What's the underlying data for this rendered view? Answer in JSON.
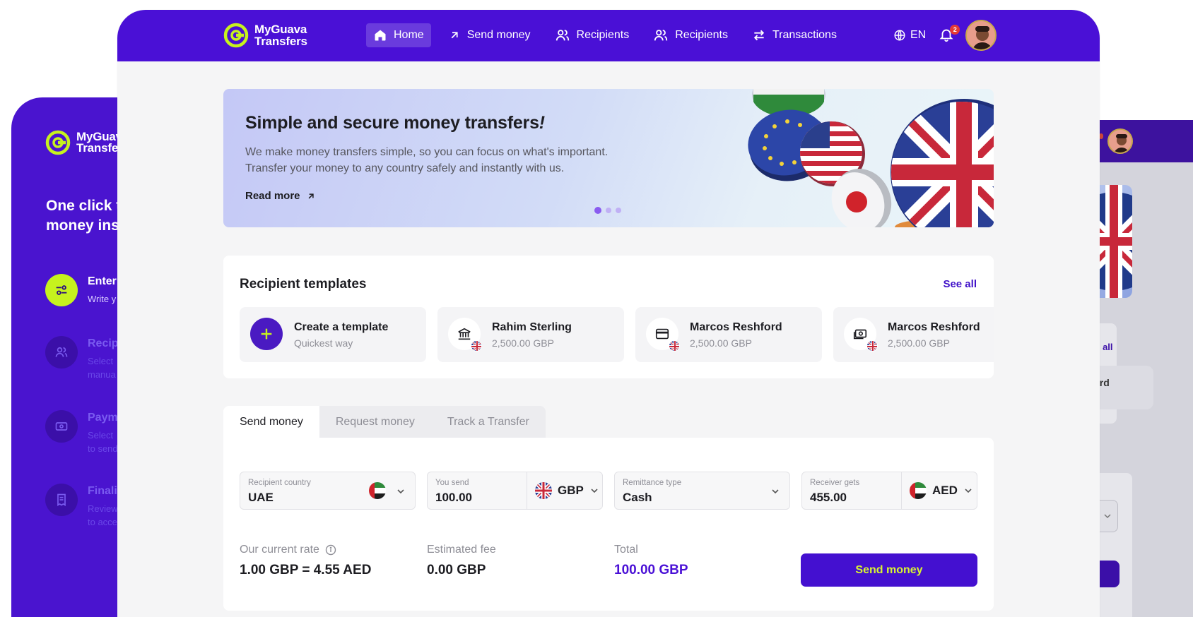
{
  "brand": {
    "line1": "MyGuava",
    "line2": "Transfers",
    "accent": "#c6f21e",
    "primary": "#4a10d6"
  },
  "back_left": {
    "brand": {
      "line1": "MyGuava",
      "line2": "Transfers"
    },
    "heading": "One click to send money instantly",
    "heading_visible": [
      "One click t",
      "money ins"
    ],
    "steps": [
      {
        "title": "Enter",
        "desc": [
          "Write y"
        ],
        "icon": "sliders-icon",
        "state": "active"
      },
      {
        "title": "Recip",
        "desc": [
          "Select",
          "manua"
        ],
        "icon": "users-icon",
        "state": "dim"
      },
      {
        "title": "Paym",
        "desc": [
          "Select",
          "to send"
        ],
        "icon": "cash-icon",
        "state": "dim"
      },
      {
        "title": "Finali",
        "desc": [
          "Review",
          "to acce"
        ],
        "icon": "receipt-icon",
        "state": "dim"
      }
    ]
  },
  "back_right": {
    "see_all": "ee all",
    "recipient": "hford"
  },
  "nav": {
    "items": [
      {
        "label": "Home",
        "icon": "home-icon",
        "active": true
      },
      {
        "label": "Send money",
        "icon": "arrow-up-right-icon",
        "active": false
      },
      {
        "label": "Recipients",
        "icon": "users-icon",
        "active": false
      },
      {
        "label": "Recipients",
        "icon": "users-icon",
        "active": false
      },
      {
        "label": "Transactions",
        "icon": "swap-icon",
        "active": false
      }
    ],
    "language": "EN",
    "notifications": "2"
  },
  "hero": {
    "title": "Simple and secure money transfers",
    "title_suffix": "!",
    "desc_line1": "We make money transfers simple, so you can focus on what's important.",
    "desc_line2": "Transfer your money to any country safely and instantly with us.",
    "link": "Read more",
    "slides": 3,
    "active_slide": 0
  },
  "templates": {
    "title": "Recipient templates",
    "see_all": "See all",
    "create": {
      "name": "Create a template",
      "sub": "Quickest way"
    },
    "items": [
      {
        "name": "Rahim Sterling",
        "amount": "2,500.00 GBP",
        "icon": "bank-icon",
        "flag": "uk"
      },
      {
        "name": "Marcos Reshford",
        "amount": "2,500.00 GBP",
        "icon": "card-icon",
        "flag": "uk"
      },
      {
        "name": "Marcos Reshford",
        "amount": "2,500.00 GBP",
        "icon": "cash-icon",
        "flag": "uk"
      }
    ]
  },
  "tabs": [
    {
      "label": "Send money",
      "active": true
    },
    {
      "label": "Request money",
      "active": false
    },
    {
      "label": "Track a Transfer",
      "active": false
    }
  ],
  "form": {
    "recipient_country": {
      "label": "Recipient country",
      "value": "UAE",
      "flag": "uae"
    },
    "you_send": {
      "label": "You send",
      "value": "100.00",
      "currency": "GBP",
      "flag": "uk"
    },
    "remittance": {
      "label": "Remittance type",
      "value": "Cash"
    },
    "receiver_gets": {
      "label": "Receiver gets",
      "value": "455.00",
      "currency": "AED",
      "flag": "uae"
    },
    "rate": {
      "label": "Our current rate",
      "value": "1.00 GBP = 4.55 AED"
    },
    "fee": {
      "label": "Estimated fee",
      "value": "0.00 GBP"
    },
    "total": {
      "label": "Total",
      "value": "100.00 GBP"
    },
    "submit": "Send money"
  }
}
